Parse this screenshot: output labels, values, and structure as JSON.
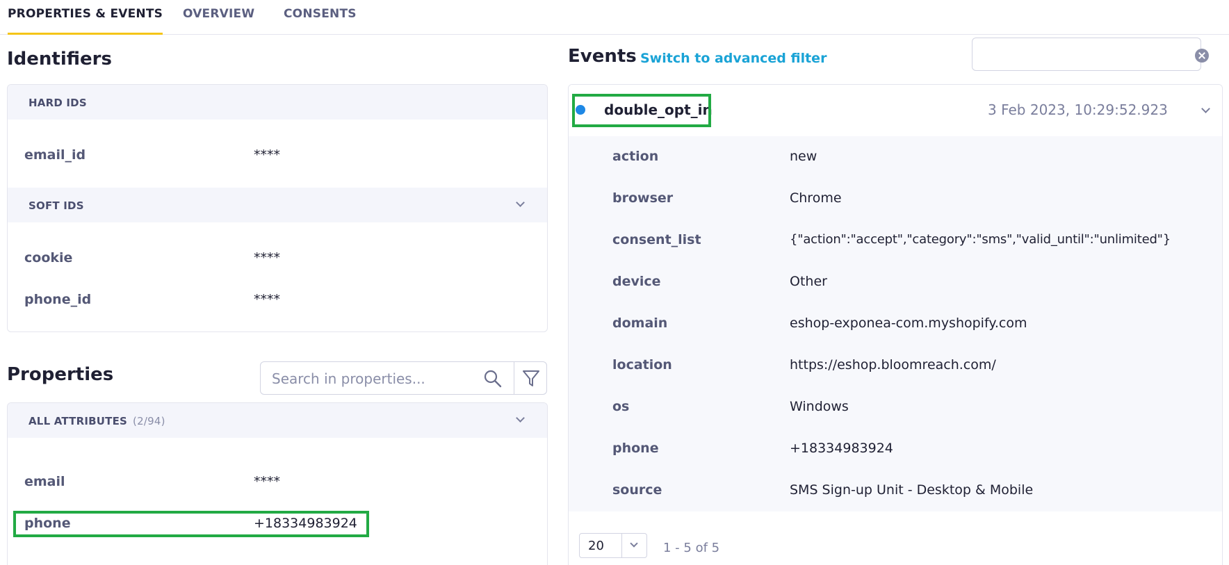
{
  "tabs": [
    {
      "label": "PROPERTIES & EVENTS",
      "active": true
    },
    {
      "label": "OVERVIEW",
      "active": false
    },
    {
      "label": "CONSENTS",
      "active": false
    }
  ],
  "identifiers": {
    "title": "Identifiers",
    "hard_ids_label": "HARD IDS",
    "hard_ids": [
      {
        "key": "email_id",
        "value": "****"
      }
    ],
    "soft_ids_label": "SOFT IDS",
    "soft_ids": [
      {
        "key": "cookie",
        "value": "****"
      },
      {
        "key": "phone_id",
        "value": "****"
      }
    ]
  },
  "properties": {
    "title": "Properties",
    "search_placeholder": "Search in properties...",
    "all_attributes_label": "ALL ATTRIBUTES",
    "all_attributes_count": "(2/94)",
    "items": [
      {
        "key": "email",
        "value": "****"
      },
      {
        "key": "phone",
        "value": "+18334983924"
      }
    ]
  },
  "events": {
    "title": "Events",
    "advanced_filter_label": "Switch to advanced filter",
    "search_value": "",
    "items": [
      {
        "name": "double_opt_in",
        "timestamp": "3 Feb 2023, 10:29:52.923",
        "status_color": "#1e88e5",
        "attributes": [
          {
            "key": "action",
            "value": "new"
          },
          {
            "key": "browser",
            "value": "Chrome"
          },
          {
            "key": "consent_list",
            "value": "{\"action\":\"accept\",\"category\":\"sms\",\"valid_until\":\"unlimited\"}"
          },
          {
            "key": "device",
            "value": "Other"
          },
          {
            "key": "domain",
            "value": "eshop-exponea-com.myshopify.com"
          },
          {
            "key": "location",
            "value": "https://eshop.bloomreach.com/"
          },
          {
            "key": "os",
            "value": "Windows"
          },
          {
            "key": "phone",
            "value": "+18334983924"
          },
          {
            "key": "source",
            "value": "SMS Sign-up Unit - Desktop & Mobile"
          }
        ]
      }
    ],
    "pagination": {
      "page_size": "20",
      "range_label": "1 - 5 of 5"
    }
  },
  "colors": {
    "accent_tab": "#f5c518",
    "link": "#1aa3d6",
    "highlight": "#22aa44"
  }
}
